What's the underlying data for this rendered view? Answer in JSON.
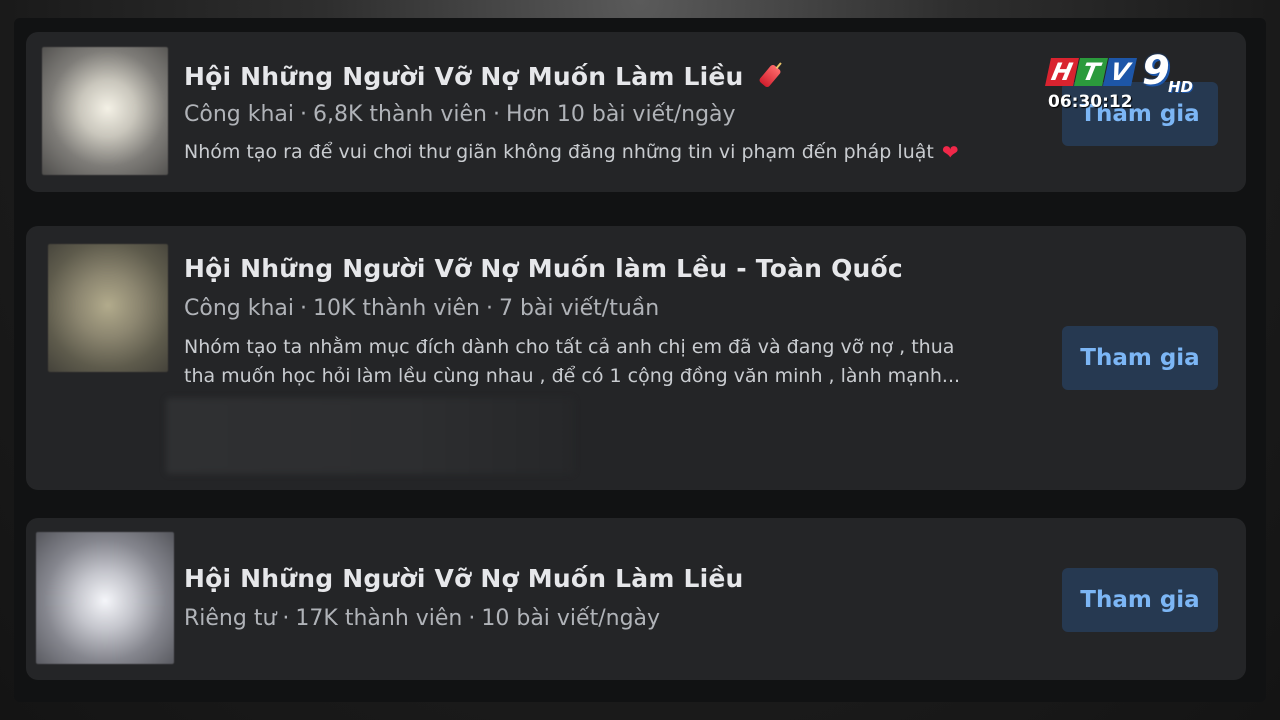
{
  "groups": [
    {
      "title": "Hội Những Người Vỡ Nợ Muốn Làm Liều",
      "title_icon": "firecracker-icon",
      "privacy": "Công khai",
      "members": "6,8K thành viên",
      "activity": "Hơn 10 bài viết/ngày",
      "description_lines": [
        "Nhóm tạo ra để vui chơi thư giãn không đăng những tin vi phạm đến pháp luật"
      ],
      "description_icon": "heart-icon",
      "button": "Tham gia"
    },
    {
      "title": "Hội Những Người Vỡ Nợ Muốn làm Lều - Toàn Quốc",
      "privacy": "Công khai",
      "members": "10K thành viên",
      "activity": "7 bài viết/tuần",
      "description_lines": [
        "Nhóm tạo ta nhằm mục đích dành cho tất cả anh chị em đã và đang vỡ nợ , thua",
        "tha muốn học hỏi làm lều cùng nhau , để có 1 cộng đồng văn minh , lành mạnh..."
      ],
      "button": "Tham gia"
    },
    {
      "title": "Hội Những Người Vỡ Nợ Muốn Làm Liều",
      "privacy": "Riêng tư",
      "members": "17K thành viên",
      "activity": "10 bài viết/ngày",
      "button": "Tham gia"
    }
  ],
  "separator": "·",
  "overlay": {
    "logo_letters": [
      "H",
      "T",
      "V"
    ],
    "logo_number": "9",
    "logo_hd": "HD",
    "time": "06:30:12"
  },
  "colors": {
    "card_bg": "#242527",
    "button_bg": "#263951",
    "button_text": "#7cb6f5",
    "logo_red": "#d9232f",
    "logo_green": "#2b9a3c",
    "logo_blue": "#1d56a8"
  }
}
